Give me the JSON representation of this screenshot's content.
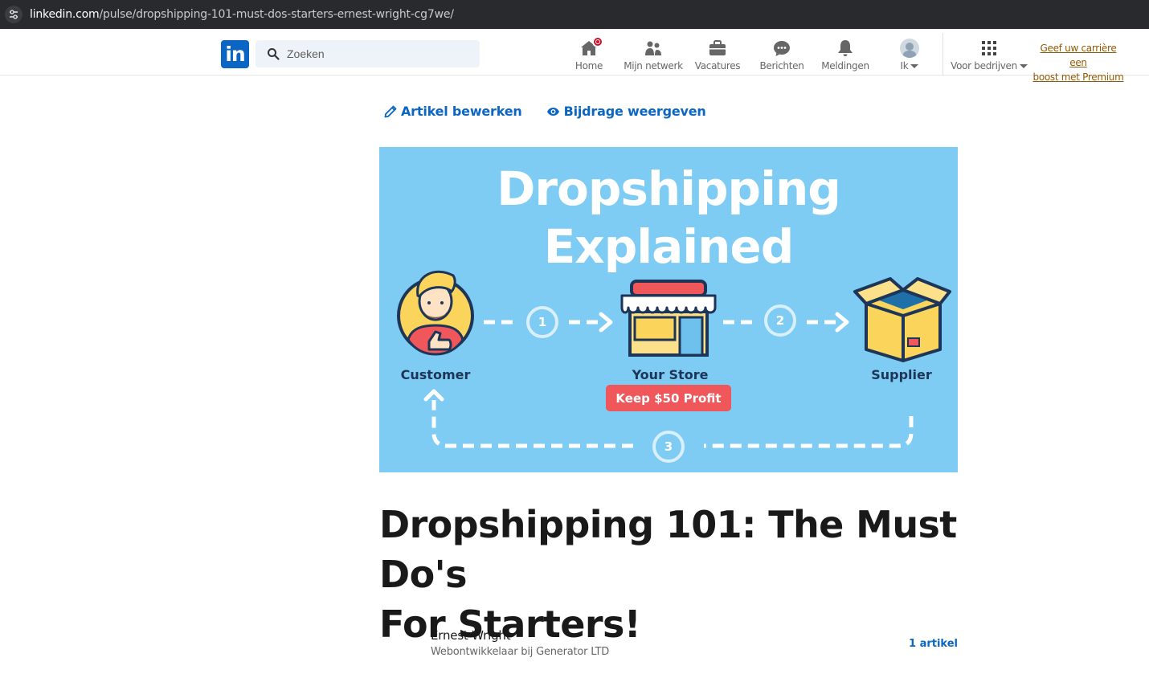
{
  "browser": {
    "url_host": "linkedin.com",
    "url_path": "/pulse/dropshipping-101-must-dos-starters-ernest-wright-cg7we/"
  },
  "nav": {
    "logo_text": "in",
    "search_placeholder": "Zoeken",
    "items": [
      {
        "label": "Home",
        "icon": "home-icon",
        "badge": true
      },
      {
        "label": "Mijn netwerk",
        "icon": "network-icon"
      },
      {
        "label": "Vacatures",
        "icon": "briefcase-icon"
      },
      {
        "label": "Berichten",
        "icon": "messaging-icon"
      },
      {
        "label": "Meldingen",
        "icon": "bell-icon"
      },
      {
        "label": "Ik",
        "icon": "avatar-icon"
      },
      {
        "label": "Voor bedrijven",
        "icon": "grid-icon"
      }
    ],
    "premium_line1": "Geef uw carrière een",
    "premium_line2": "boost met Premium"
  },
  "actions": {
    "edit_label": "Artikel bewerken",
    "view_label": "Bijdrage weergeven"
  },
  "banner": {
    "title_line1": "Dropshipping",
    "title_line2": "Explained",
    "customer_label": "Customer",
    "store_label": "Your Store",
    "supplier_label": "Supplier",
    "profit_label": "Keep $50 Profit",
    "step1": "1",
    "step2": "2",
    "step3": "3",
    "colors": {
      "background": "#7ecbf3",
      "profit": "#f0575a",
      "label": "#1d3557"
    }
  },
  "article": {
    "title_line1": "Dropshipping 101: The Must Do's",
    "title_line2": "For Starters!"
  },
  "author": {
    "name": "Ernest Wright",
    "headline": "Webontwikkelaar bij Generator LTD",
    "articles": "1 artikel"
  },
  "colors": {
    "linkedin_blue": "#0a66c2",
    "premium": "#915907"
  }
}
